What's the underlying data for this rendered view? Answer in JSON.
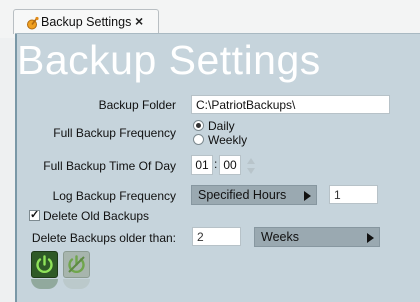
{
  "tab": {
    "title": "Backup Settings",
    "close_glyph": "×",
    "icon": "backup-icon"
  },
  "page_title": "Backup Settings",
  "form": {
    "backup_folder": {
      "label": "Backup Folder",
      "value": "C:\\PatriotBackups\\"
    },
    "full_backup_frequency": {
      "label": "Full Backup Frequency",
      "options": [
        "Daily",
        "Weekly"
      ],
      "selected": "Daily"
    },
    "full_backup_time": {
      "label": "Full Backup Time Of Day",
      "hour": "01",
      "separator": ":",
      "minute": "00"
    },
    "log_backup_frequency": {
      "label": "Log Backup Frequency",
      "unit": "Specified Hours",
      "value": "1"
    },
    "delete_old_backups": {
      "label": "Delete Old Backups",
      "checked": true,
      "check_glyph": "✓"
    },
    "delete_older_than": {
      "label": "Delete Backups older than:",
      "value": "2",
      "unit": "Weeks"
    }
  },
  "actions": {
    "enable_icon": "power-icon",
    "disable_icon": "power-off-icon"
  },
  "colors": {
    "panel": "#c6d4dc",
    "title": "#ffffff",
    "button_on": "#3d6b2e",
    "button_off": "#9aaaa0",
    "icon_green": "#8fe35a"
  }
}
